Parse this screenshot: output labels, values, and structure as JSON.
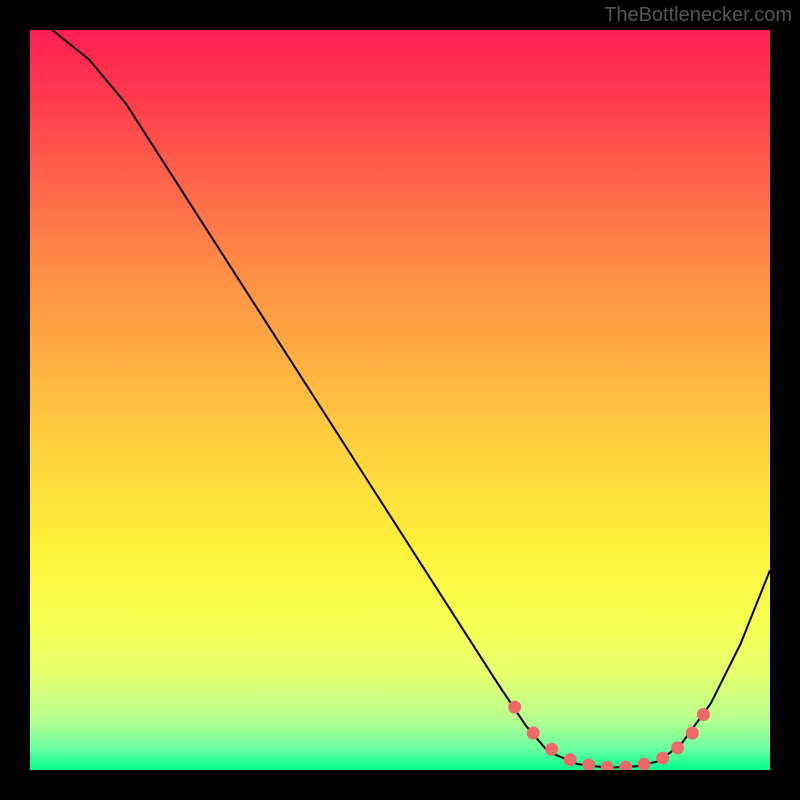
{
  "watermark": "TheBottlenecker.com",
  "chart_data": {
    "type": "line",
    "title": "",
    "xlabel": "",
    "ylabel": "",
    "xlim": [
      0,
      100
    ],
    "ylim": [
      0,
      100
    ],
    "curve_points": [
      [
        3,
        100
      ],
      [
        8,
        96
      ],
      [
        13,
        90
      ],
      [
        63,
        12
      ],
      [
        67,
        6
      ],
      [
        70,
        2.5
      ],
      [
        74,
        0.8
      ],
      [
        78,
        0.3
      ],
      [
        82,
        0.5
      ],
      [
        85,
        1.2
      ],
      [
        88,
        3.5
      ],
      [
        92,
        9
      ],
      [
        96,
        17
      ],
      [
        100,
        27
      ]
    ],
    "markers": [
      [
        65.5,
        8.5
      ],
      [
        68,
        5
      ],
      [
        70.5,
        2.8
      ],
      [
        73,
        1.4
      ],
      [
        75.5,
        0.7
      ],
      [
        78,
        0.35
      ],
      [
        80.5,
        0.4
      ],
      [
        83,
        0.8
      ],
      [
        85.5,
        1.6
      ],
      [
        87.5,
        3
      ],
      [
        89.5,
        5
      ],
      [
        91,
        7.5
      ]
    ],
    "marker_color": "#f06868",
    "curve_color": "#000000"
  }
}
